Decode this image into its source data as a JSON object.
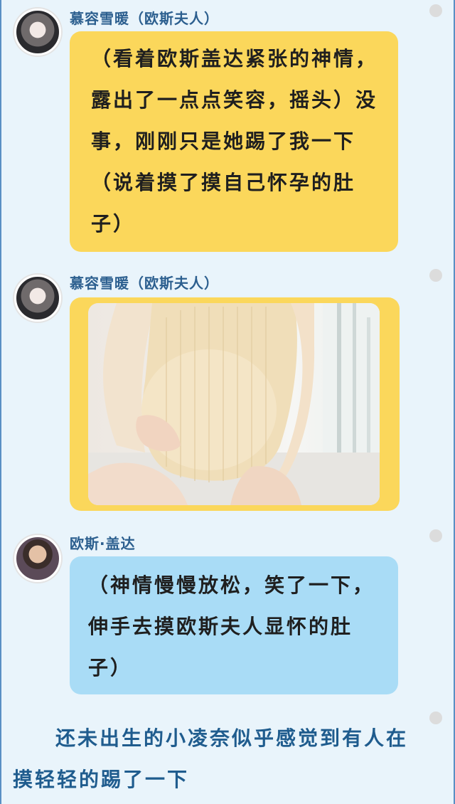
{
  "messages": [
    {
      "sender": "慕容雪暖（欧斯夫人）",
      "lines": [
        "（看着欧斯盖达紧张的神情，",
        "露出了一点点笑容，摇头）没",
        "事，刚刚只是她踢了我一下",
        "（说着摸了摸自己怀孕的肚",
        "子）"
      ]
    },
    {
      "sender": "慕容雪暖（欧斯夫人）",
      "image": "photo-of-pregnant-belly"
    },
    {
      "sender": "欧斯·盖达",
      "lines": [
        "（神情慢慢放松，笑了一下，",
        "伸手去摸欧斯夫人显怀的肚",
        "子）"
      ]
    }
  ],
  "narration": [
    "还未出生的小凌奈似乎感觉到有人在",
    "摸轻轻的踢了一下"
  ],
  "colors": {
    "yellow_bubble": "#fbd75b",
    "blue_bubble": "#a9dcf6",
    "name_text": "#2c5f8f",
    "narration_text": "#1f5c8e",
    "background": "#e9f4fb"
  }
}
